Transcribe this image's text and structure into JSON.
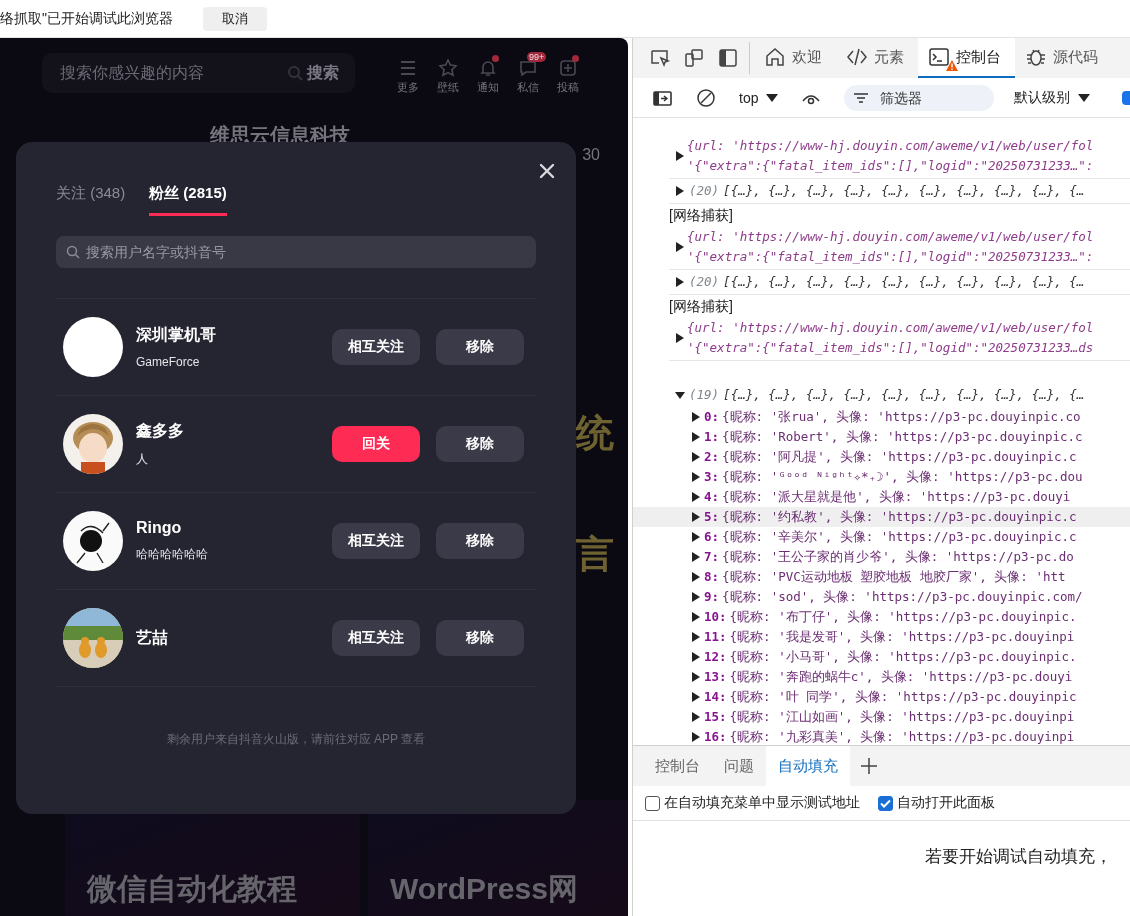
{
  "infobar": {
    "message": "络抓取\"已开始调试此浏览器",
    "cancel": "取消"
  },
  "page": {
    "search_placeholder": "搜索你感兴趣的内容",
    "search_button": "搜索",
    "nav": [
      {
        "label": "更多",
        "dot": false
      },
      {
        "label": "壁纸",
        "dot": false
      },
      {
        "label": "通知",
        "dot": true
      },
      {
        "label": "私信",
        "dot": false,
        "badge": "99+"
      },
      {
        "label": "投稿",
        "dot": true
      }
    ],
    "profile": {
      "name": "维思云信息科技",
      "stat": "30"
    },
    "banner": [
      "统",
      "言"
    ],
    "videos": [
      {
        "title": "微信自动化教程"
      },
      {
        "title": "WordPress网"
      }
    ]
  },
  "modal": {
    "tabs": [
      {
        "label": "关注 (348)",
        "selected": false
      },
      {
        "label": "粉丝 (2815)",
        "selected": true
      }
    ],
    "search_placeholder": "搜索用户名字或抖音号",
    "users": [
      {
        "name": "深圳掌机哥",
        "bio": "GameForce",
        "avatar": {
          "kind": "blank"
        },
        "buttons": [
          {
            "label": "相互关注",
            "kind": "secondary"
          },
          {
            "label": "移除",
            "kind": "secondary"
          }
        ]
      },
      {
        "name": "鑫多多",
        "bio": "人",
        "avatar": {
          "kind": "picture"
        },
        "buttons": [
          {
            "label": "回关",
            "kind": "primary"
          },
          {
            "label": "移除",
            "kind": "secondary"
          }
        ]
      },
      {
        "name": "Ringo",
        "bio": "哈哈哈哈哈哈",
        "avatar": {
          "kind": "picture"
        },
        "buttons": [
          {
            "label": "相互关注",
            "kind": "secondary"
          },
          {
            "label": "移除",
            "kind": "secondary"
          }
        ]
      },
      {
        "name": "艺喆",
        "avatar": {
          "kind": "picture"
        },
        "buttons": [
          {
            "label": "相互关注",
            "kind": "secondary"
          },
          {
            "label": "移除",
            "kind": "secondary"
          }
        ]
      }
    ],
    "footer": "剩余用户来自抖音火山版，请前往对应 APP 查看"
  },
  "devtools": {
    "tools": [
      {
        "label": "欢迎",
        "selected": false,
        "warning": false
      },
      {
        "label": "元素",
        "selected": false,
        "warning": false
      },
      {
        "label": "控制台",
        "selected": true,
        "warning": true
      },
      {
        "label": "源代码",
        "selected": false,
        "warning": false
      }
    ],
    "context": "top",
    "filter_placeholder": "筛选器",
    "level": "默认级别",
    "console": [
      {
        "kind": "request",
        "expanded": false,
        "lines": [
          "{url: 'https://www-hj.douyin.com/aweme/v1/web/user/fol",
          "'{\"extra\":{\"fatal_item_ids\":[],\"logid\":\"20250731233…\":"
        ]
      },
      {
        "kind": "array",
        "expanded": false,
        "count": "(20)",
        "text": "[{…}, {…}, {…}, {…}, {…}, {…}, {…}, {…}, {…}, {…"
      },
      {
        "kind": "label",
        "text": "[网络捕获]"
      },
      {
        "kind": "request",
        "expanded": false,
        "lines": [
          "{url: 'https://www-hj.douyin.com/aweme/v1/web/user/fol",
          "'{\"extra\":{\"fatal_item_ids\":[],\"logid\":\"20250731233…\":"
        ]
      },
      {
        "kind": "array",
        "expanded": false,
        "count": "(20)",
        "text": "[{…}, {…}, {…}, {…}, {…}, {…}, {…}, {…}, {…}, {…"
      },
      {
        "kind": "label",
        "text": "[网络捕获]"
      },
      {
        "kind": "request",
        "expanded": false,
        "lines": [
          "{url: 'https://www-hj.douyin.com/aweme/v1/web/user/fol",
          "'{\"extra\":{\"fatal_item_ids\":[],\"logid\":\"20250731233…ds"
        ]
      },
      {
        "kind": "array",
        "expanded": true,
        "count": "(19)",
        "text": "[{…}, {…}, {…}, {…}, {…}, {…}, {…}, {…}, {…}, {…",
        "items": [
          {
            "index": "0:",
            "text": "{昵称: '张rua', 头像: 'https://p3-pc.douyinpic.co",
            "highlighted": false
          },
          {
            "index": "1:",
            "text": "{昵称: 'Robert', 头像: 'https://p3-pc.douyinpic.c",
            "highlighted": false
          },
          {
            "index": "2:",
            "text": "{昵称: '阿凡提', 头像: 'https://p3-pc.douyinpic.c",
            "highlighted": false
          },
          {
            "index": "3:",
            "text": "{昵称: 'ᴳᵒᵒᵈ ᴺⁱᵍʰᵗ✧*₊☽', 头像: 'https://p3-pc.dou",
            "highlighted": false
          },
          {
            "index": "4:",
            "text": "{昵称: '派大星就是他', 头像: 'https://p3-pc.douyi",
            "highlighted": false
          },
          {
            "index": "5:",
            "text": "{昵称: '约私教', 头像: 'https://p3-pc.douyinpic.c",
            "highlighted": true
          },
          {
            "index": "6:",
            "text": "{昵称: '辛美尔', 头像: 'https://p3-pc.douyinpic.c",
            "highlighted": false
          },
          {
            "index": "7:",
            "text": "{昵称: '王公子家的肖少爷', 头像: 'https://p3-pc.do",
            "highlighted": false
          },
          {
            "index": "8:",
            "text": "{昵称: 'PVC运动地板 塑胶地板 地胶厂家', 头像: 'htt",
            "highlighted": false
          },
          {
            "index": "9:",
            "text": "{昵称: 'sod', 头像: 'https://p3-pc.douyinpic.com/",
            "highlighted": false
          },
          {
            "index": "10:",
            "text": "{昵称: '布丁仔', 头像: 'https://p3-pc.douyinpic.",
            "highlighted": false
          },
          {
            "index": "11:",
            "text": "{昵称: '我是发哥', 头像: 'https://p3-pc.douyinpi",
            "highlighted": false
          },
          {
            "index": "12:",
            "text": "{昵称: '小马哥', 头像: 'https://p3-pc.douyinpic.",
            "highlighted": false
          },
          {
            "index": "13:",
            "text": "{昵称: '奔跑的蜗牛c', 头像: 'https://p3-pc.douyi",
            "highlighted": false
          },
          {
            "index": "14:",
            "text": "{昵称: '叶 同学', 头像: 'https://p3-pc.douyinpic",
            "highlighted": false
          },
          {
            "index": "15:",
            "text": "{昵称: '江山如画', 头像: 'https://p3-pc.douyinpi",
            "highlighted": false
          },
          {
            "index": "16:",
            "text": "{昵称: '九彩真美', 头像: 'https://p3-pc.douyinpi",
            "highlighted": false
          }
        ]
      }
    ],
    "drawer": {
      "tabs": [
        {
          "label": "控制台",
          "selected": false
        },
        {
          "label": "问题",
          "selected": false
        },
        {
          "label": "自动填充",
          "selected": true
        }
      ],
      "options": [
        {
          "label": "在自动填充菜单中显示测试地址",
          "checked": false
        },
        {
          "label": "自动打开此面板",
          "checked": true
        }
      ],
      "message": "若要开始调试自动填充，"
    }
  }
}
